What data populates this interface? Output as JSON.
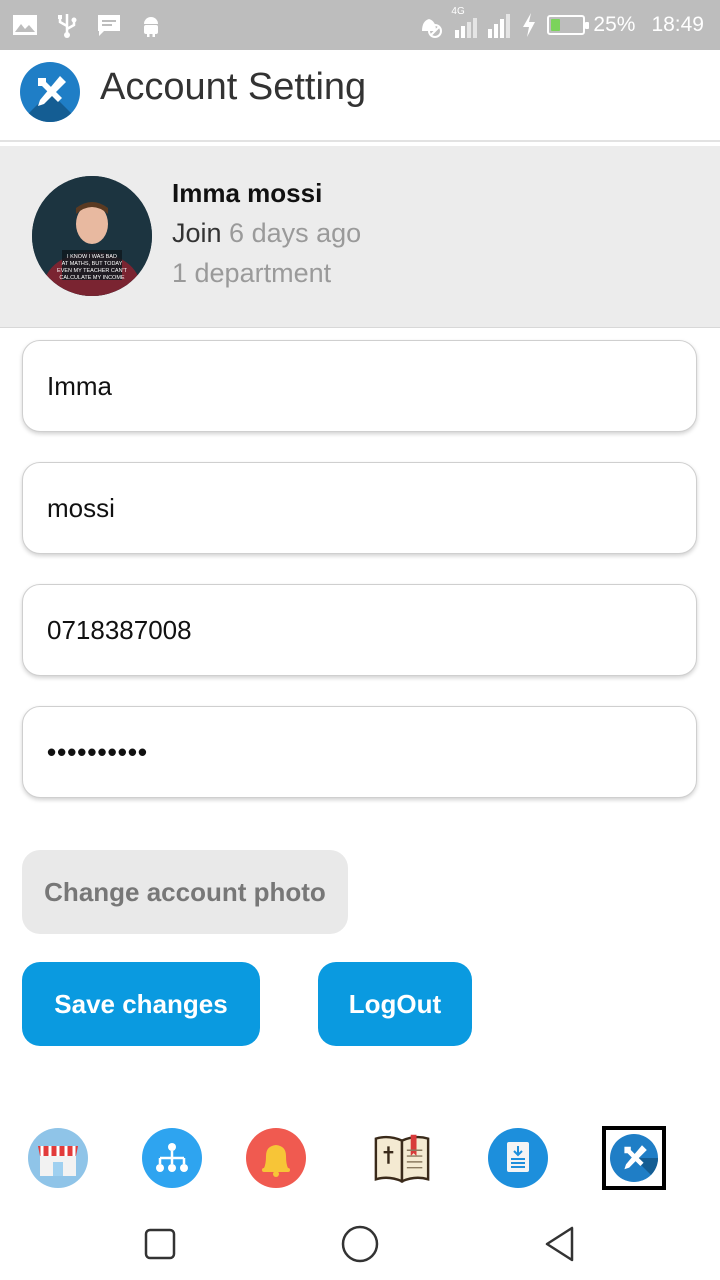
{
  "status_bar": {
    "battery_percent": "25%",
    "time": "18:49",
    "network": "4G",
    "battery_level": 0.25,
    "left_icons": [
      "image-icon",
      "usb-icon",
      "message-icon",
      "android-icon"
    ]
  },
  "app_bar": {
    "title": "Account Setting",
    "logo_icon": "tools-icon"
  },
  "profile": {
    "name": "Imma mossi",
    "join_prefix": "Join",
    "join_time": "6 days ago",
    "department": "1 department",
    "avatar_caption": "I KNOW I WAS BAD AT MATHS, BUT TODAY EVEN MY TEACHER CAN'T CALCULATE MY INCOME"
  },
  "form": {
    "first_name": "Imma",
    "last_name": "mossi",
    "phone": "0718387008",
    "password": "••••••••••"
  },
  "buttons": {
    "change_photo": "Change account photo",
    "save": "Save changes",
    "logout": "LogOut"
  },
  "tabs": [
    {
      "name": "store-icon"
    },
    {
      "name": "hierarchy-icon"
    },
    {
      "name": "bell-icon"
    },
    {
      "name": "bible-icon"
    },
    {
      "name": "document-icon"
    },
    {
      "name": "tools-icon",
      "active": true
    }
  ],
  "colors": {
    "primary": "#0a9ae0",
    "status_bar": "#bdbdbd",
    "profile_bg": "#ececec",
    "bell_bg": "#f05a50",
    "logo_bg": "#1f7ec6"
  }
}
